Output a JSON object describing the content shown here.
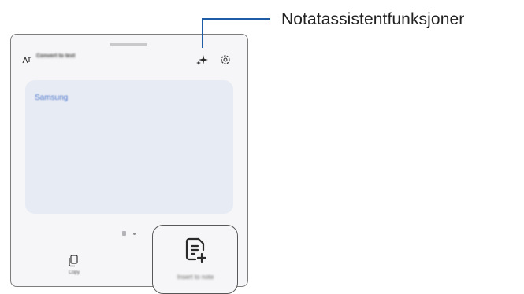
{
  "panel": {
    "title": "Convert to text",
    "text_area": {
      "content": "Samsung"
    },
    "copy_button": {
      "label": "Copy"
    },
    "note_button": {
      "label": "Insert to note"
    }
  },
  "icons": {
    "translate": "text-translate-icon",
    "assist": "sparkle-icon",
    "settings": "gear-icon",
    "copy": "copy-icon",
    "note": "note-add-icon"
  },
  "callout": {
    "label": "Notatassistentfunksjoner"
  },
  "colors": {
    "accent_text": "#4f77c9",
    "callout_line": "#1e5ca8",
    "text_area_bg": "#e7ebf4"
  }
}
